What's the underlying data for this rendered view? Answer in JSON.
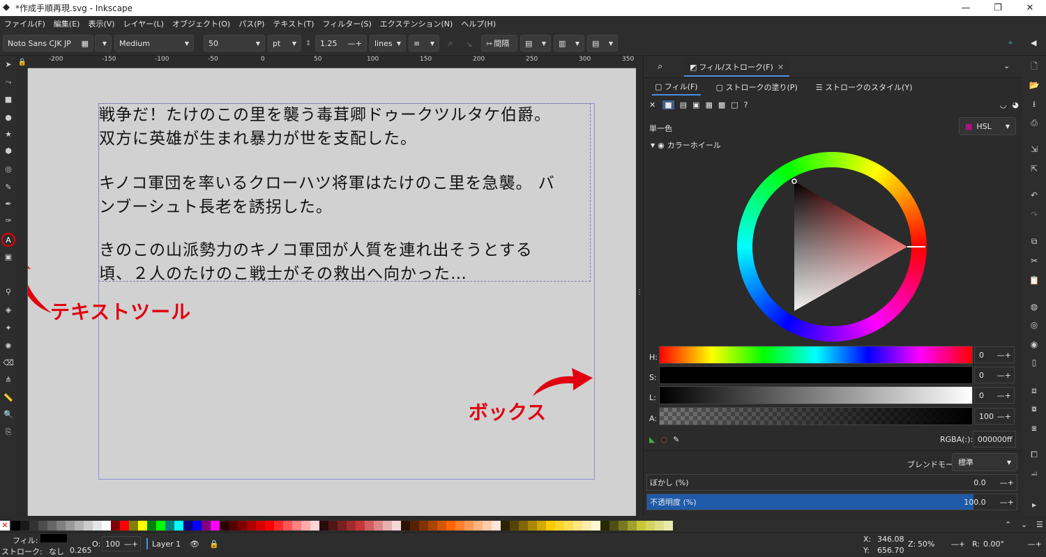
{
  "window": {
    "title": "*作成手順再現.svg - Inkscape",
    "minimize": "—",
    "maximize": "❐",
    "close": "✕"
  },
  "menu": [
    "ファイル(F)",
    "編集(E)",
    "表示(V)",
    "レイヤー(L)",
    "オブジェクト(O)",
    "パス(P)",
    "テキスト(T)",
    "フィルター(S)",
    "エクステンション(N)",
    "ヘルプ(H)"
  ],
  "toolbar": {
    "font_family": "Noto Sans CJK JP",
    "font_style": "Medium",
    "font_size": "50",
    "unit": "pt",
    "line_spacing": "1.25",
    "spacing_mode": "lines",
    "spacing_btn": "間隔"
  },
  "ruler_ticks": [
    "-200",
    "-150",
    "-100",
    "-50",
    "0",
    "50",
    "100",
    "150",
    "200",
    "250",
    "300",
    "350"
  ],
  "canvas": {
    "paragraphs": [
      [
        "戦争だ！たけのこの里を襲う毒茸卿ドゥークツルタケ伯爵。",
        "双方に英雄が生まれ暴力が世を支配した。"
      ],
      [
        "キノコ軍団を率いるクローハツ将軍はたけのこ里を急襲。 バ",
        "ンブーシュト長老を誘拐した。"
      ],
      [
        "きのこの山派勢力のキノコ軍団が人質を連れ出そうとする",
        "頃、２人のたけのこ戦士がその救出へ向かった…"
      ]
    ],
    "annotation_text_tool": "テキストツール",
    "annotation_box": "ボックス"
  },
  "panel": {
    "tab_fill_stroke": "フィル/ストローク(F)",
    "subtab_fill": "フィル(F)",
    "subtab_stroke_paint": "ストロークの塗り(P)",
    "subtab_stroke_style": "ストロークのスタイル(Y)",
    "flat_color": "単一色",
    "color_mode": "HSL",
    "wheel_label": "カラーホイール",
    "rows": [
      {
        "label": "H:",
        "value": "0"
      },
      {
        "label": "S:",
        "value": "0"
      },
      {
        "label": "L:",
        "value": "0"
      },
      {
        "label": "A:",
        "value": "100"
      }
    ],
    "rgba_label": "RGBA(:):",
    "rgba_value": "000000ff",
    "blend_label": "ブレンドモード:",
    "blend_value": "標準",
    "blur_label": "ぼかし (%)",
    "blur_value": "0.0",
    "opacity_label": "不透明度 (%)",
    "opacity_value": "100.0"
  },
  "status": {
    "fill_label": "フィル:",
    "stroke_label": "ストローク:",
    "stroke_value": "なし",
    "stroke_width": "0.265",
    "o_label": "O:",
    "o_value": "100",
    "layer": "Layer 1",
    "x_label": "X:",
    "x_value": "346.08",
    "y_label": "Y:",
    "y_value": "656.70",
    "z_label": "Z:",
    "zoom": "50%",
    "r_label": "R:",
    "rotation": "0.00°"
  },
  "palette_colors": [
    "#000000",
    "#1a1a1a",
    "#333333",
    "#4d4d4d",
    "#666666",
    "#808080",
    "#999999",
    "#b3b3b3",
    "#cccccc",
    "#e6e6e6",
    "#ffffff",
    "#800000",
    "#ff0000",
    "#808000",
    "#ffff00",
    "#008000",
    "#00ff00",
    "#008080",
    "#00ffff",
    "#000080",
    "#0000ff",
    "#800080",
    "#ff00ff",
    "#2b0000",
    "#550000",
    "#800000",
    "#aa0000",
    "#d40000",
    "#ff0000",
    "#ff2a2a",
    "#ff5555",
    "#ff8080",
    "#ffaaaa",
    "#ffd5d5",
    "#280b0b",
    "#501616",
    "#782121",
    "#a02c2c",
    "#c83737",
    "#d35f5f",
    "#de8787",
    "#e9afaf",
    "#f4d7d7",
    "#2b1100",
    "#552200",
    "#803300",
    "#aa4400",
    "#d45500",
    "#ff6600",
    "#ff7f2a",
    "#ff9955",
    "#ffb380",
    "#ffccaa",
    "#ffe6d5",
    "#2b2200",
    "#554400",
    "#806600",
    "#aa8800",
    "#d4aa00",
    "#ffcc00",
    "#ffd42a",
    "#ffdd55",
    "#ffe680",
    "#ffeeaa",
    "#fff6d5",
    "#282800",
    "#505016",
    "#787821",
    "#a0a02c",
    "#c8c837",
    "#d3d35f",
    "#dede87",
    "#e9e9af"
  ]
}
